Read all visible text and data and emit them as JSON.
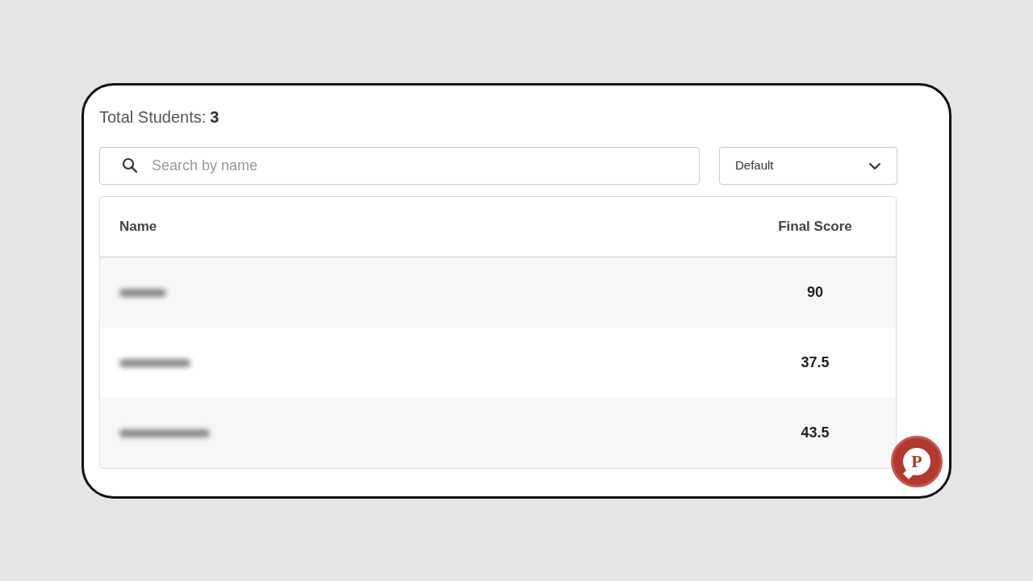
{
  "summary": {
    "label": "Total Students:",
    "count": "3"
  },
  "search": {
    "placeholder": "Search by name"
  },
  "sort_dropdown": {
    "value": "Default"
  },
  "table": {
    "columns": [
      "Name",
      "Final Score"
    ],
    "rows": [
      {
        "name_blurred": true,
        "score": "90"
      },
      {
        "name_blurred": true,
        "score": "37.5"
      },
      {
        "name_blurred": true,
        "score": "43.5"
      }
    ]
  },
  "chat_button": {
    "letter": "P"
  }
}
